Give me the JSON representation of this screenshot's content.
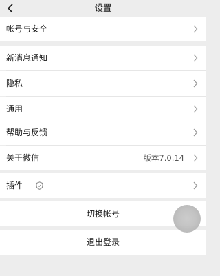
{
  "header": {
    "title": "设置"
  },
  "settings": {
    "account_security": "帐号与安全",
    "new_message_notifications": "新消息通知",
    "privacy": "隐私",
    "general": "通用",
    "help_feedback": "帮助与反馈",
    "about_wechat": "关于微信",
    "version": "版本7.0.14",
    "plugins": "插件"
  },
  "actions": {
    "switch_account": "切换帐号",
    "logout": "退出登录"
  },
  "icons": {
    "back": "chevron-left-icon",
    "chevron": "chevron-right-icon",
    "plugin_badge": "shield-icon"
  }
}
